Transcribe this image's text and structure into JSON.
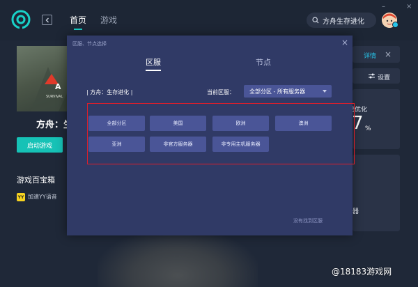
{
  "header": {
    "tabs": [
      {
        "label": "首页",
        "active": true
      },
      {
        "label": "游戏",
        "active": false
      }
    ],
    "search": {
      "value": "方舟生存进化",
      "icon": "search-icon"
    },
    "window_controls": {
      "minimize": "–",
      "close": "×"
    }
  },
  "game": {
    "title": "方舟：生",
    "cover_text": "A R",
    "cover_subtext": "SURVIVAL",
    "start_label": "启动游戏"
  },
  "toolbox": {
    "title": "游戏百宝箱",
    "items": [
      {
        "label": "加速YY语音",
        "icon": "yy-icon",
        "icon_text": "YY"
      }
    ]
  },
  "right_panel": {
    "details_label": "详情",
    "close": "×",
    "settings_label": "设置",
    "optimize_text": "已优化",
    "big_number": "7",
    "percent": "%",
    "partial_text": "器"
  },
  "modal": {
    "caption": "区服、节点选择",
    "close": "×",
    "tabs": [
      {
        "label": "区服",
        "active": true
      },
      {
        "label": "节点",
        "active": false
      }
    ],
    "game_label": "| 方舟：生存进化 |",
    "current_region_label": "当前区服：",
    "current_region_value": "全部分区 - 所有服务器",
    "options": [
      "全部分区",
      "美国",
      "欧洲",
      "澳洲",
      "亚洲",
      "非官方服务器",
      "非专用主机服务器"
    ],
    "not_found_label": "没有找到区服"
  },
  "watermark": "@18183游戏网",
  "colors": {
    "accent": "#19d2c9",
    "start_button": "#16c2b6",
    "modal_bg": "#303a66",
    "option_bg": "#4a5597",
    "highlight_frame": "#e01e2a"
  }
}
